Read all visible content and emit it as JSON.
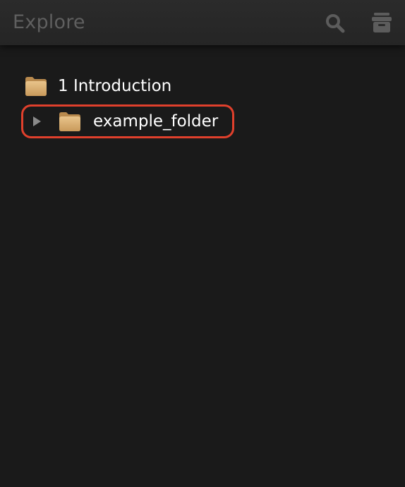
{
  "header": {
    "title": "Explore",
    "search_icon": "search-icon",
    "archive_icon": "archive-icon"
  },
  "tree": {
    "items": [
      {
        "label": "1 Introduction",
        "icon": "folder-icon",
        "expandable": false
      },
      {
        "label": "example_folder",
        "icon": "folder-icon",
        "expandable": true,
        "expanded": false
      }
    ]
  },
  "colors": {
    "background": "#1a1a1a",
    "header": "#282828",
    "title_text": "#5f5f5f",
    "item_text": "#ffffff",
    "folder": "#d4a96a",
    "highlight": "#e0402c"
  }
}
